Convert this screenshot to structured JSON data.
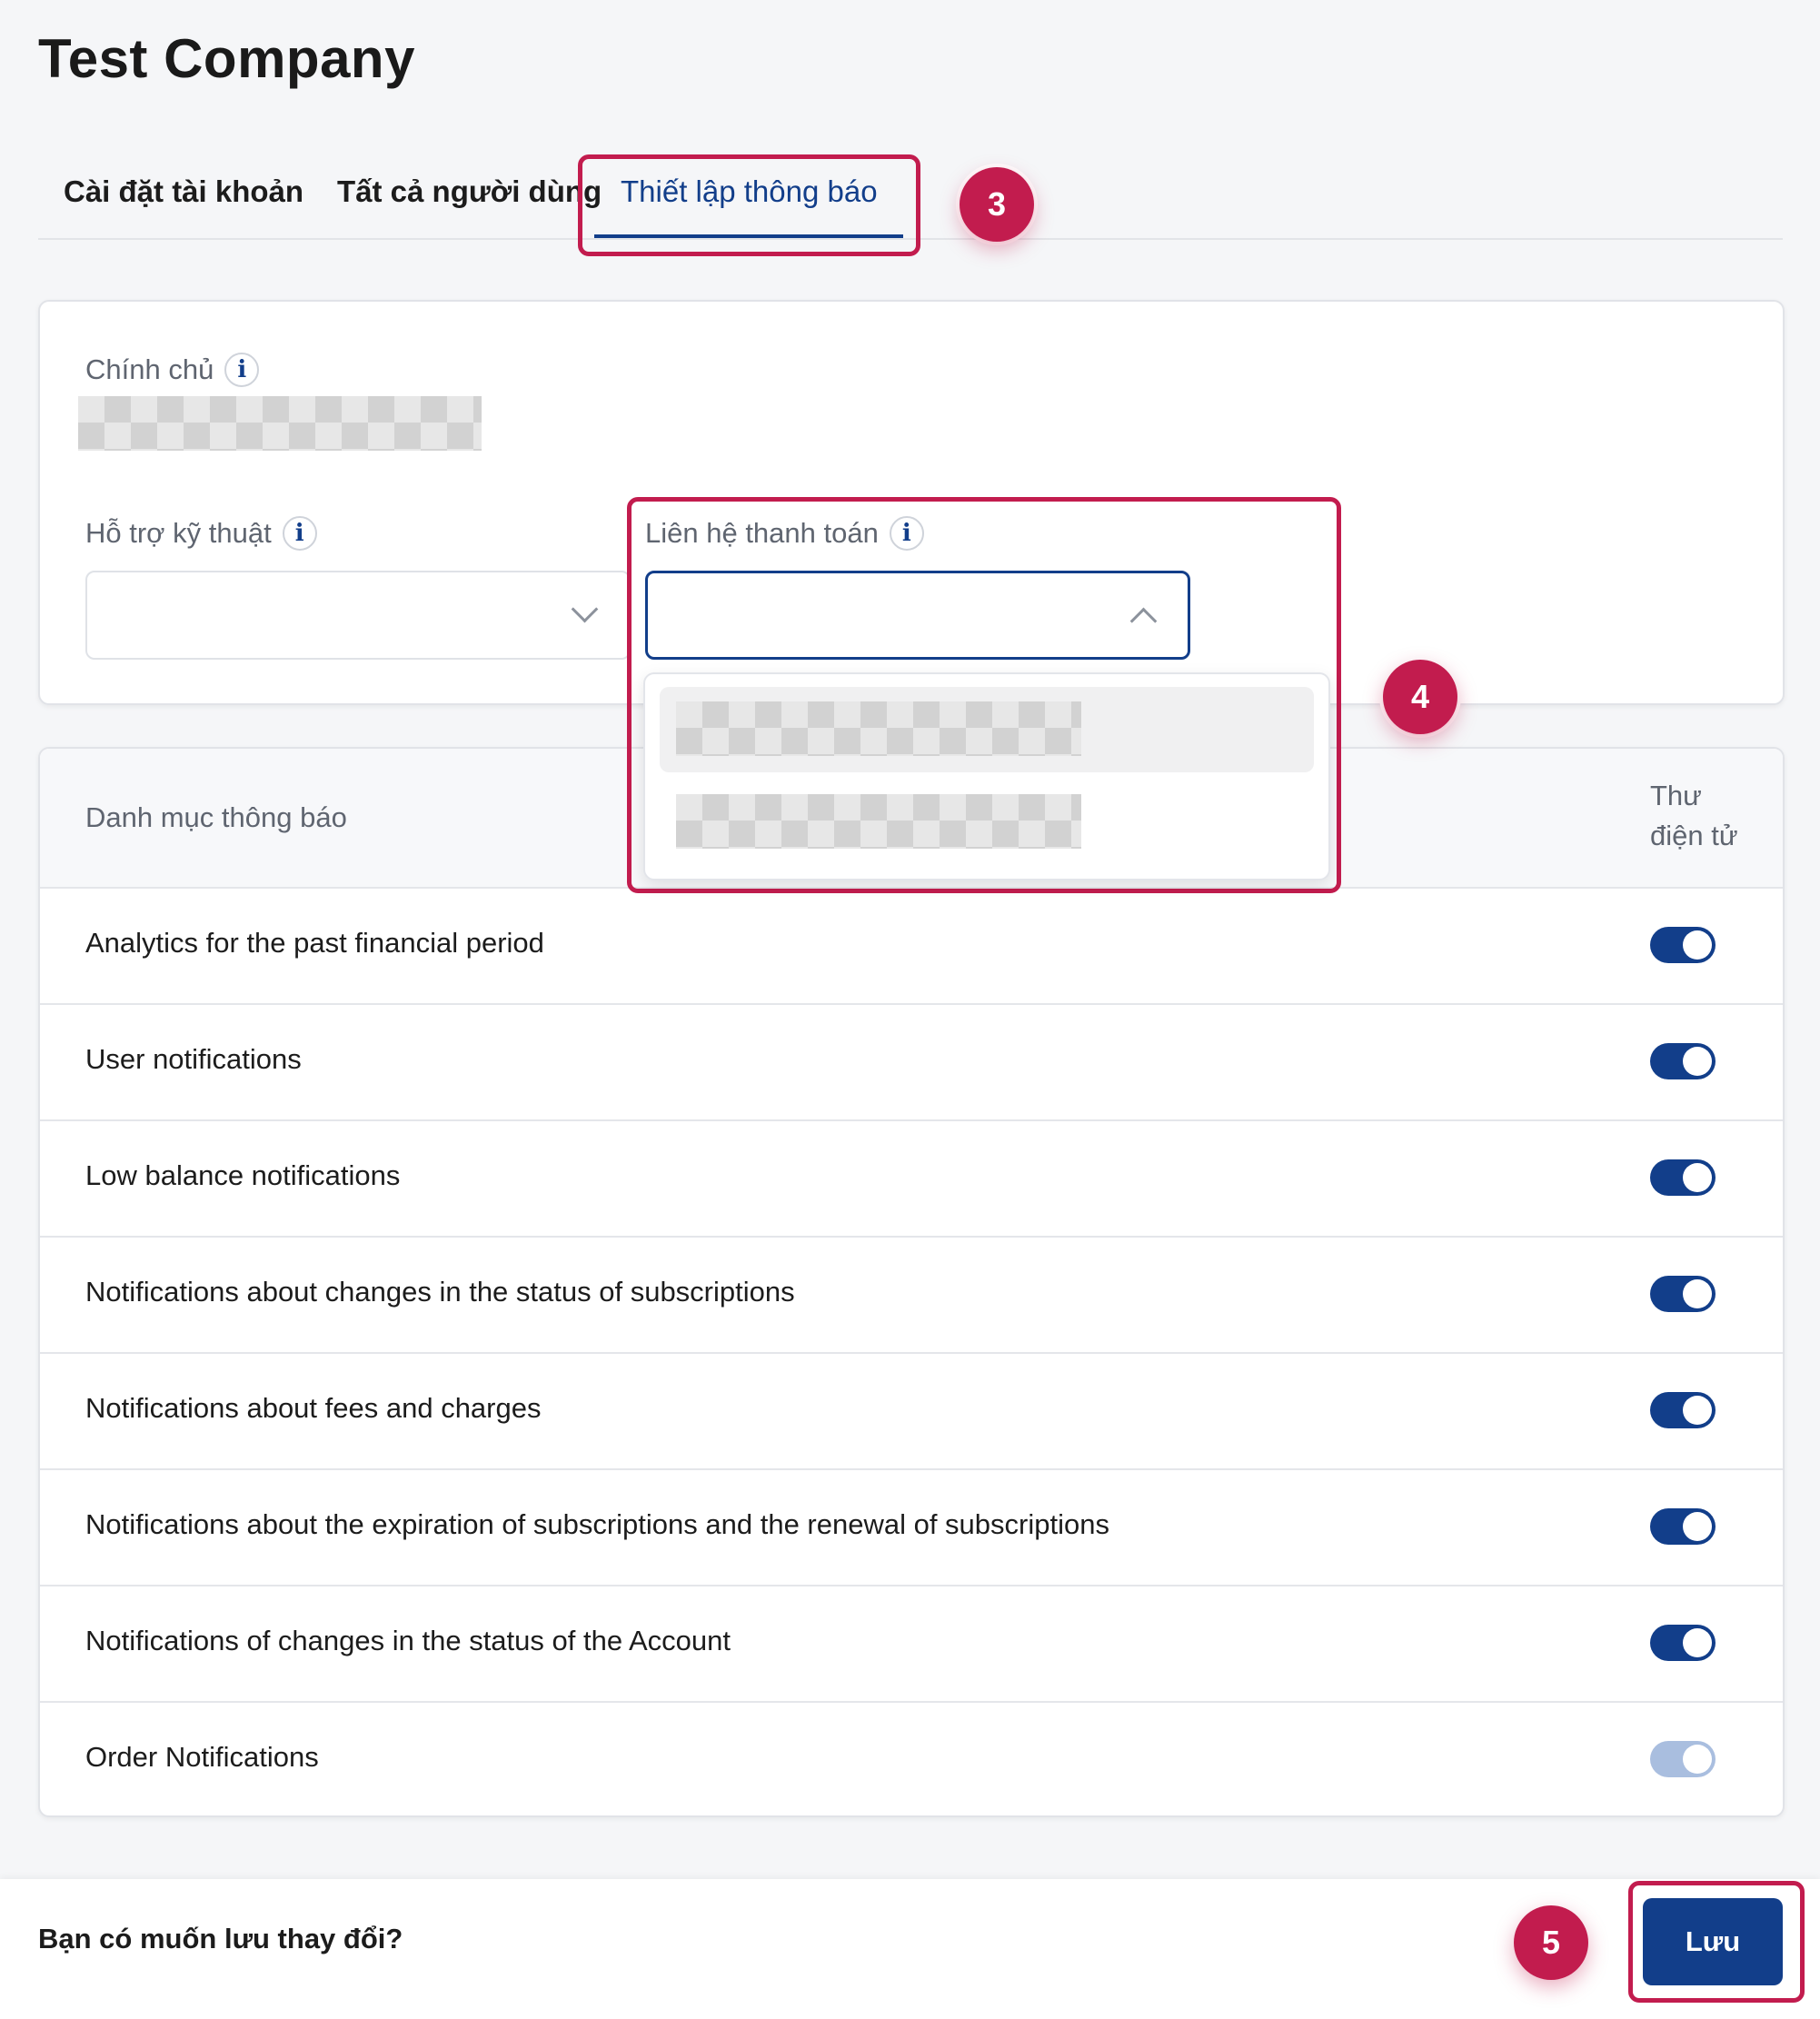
{
  "page": {
    "title": "Test Company"
  },
  "tabs": [
    {
      "label": "Cài đặt tài khoản"
    },
    {
      "label": "Tất cả người dùng"
    },
    {
      "label": "Thiết lập thông báo",
      "active": true
    }
  ],
  "contacts": {
    "owner_label": "Chính chủ",
    "tech_support_label": "Hỗ trợ kỹ thuật",
    "billing_label": "Liên hệ thanh toán",
    "tech_support_value": "",
    "billing_value": ""
  },
  "table": {
    "header_left": "Danh mục thông báo",
    "header_right": "Thư điện tử",
    "rows": [
      {
        "label": "Analytics for the past financial period",
        "enabled": true
      },
      {
        "label": "User notifications",
        "enabled": true
      },
      {
        "label": "Low balance notifications",
        "enabled": true
      },
      {
        "label": "Notifications about changes in the status of subscriptions",
        "enabled": true
      },
      {
        "label": "Notifications about fees and charges",
        "enabled": true
      },
      {
        "label": "Notifications about the expiration of subscriptions and the renewal of subscriptions",
        "enabled": true
      },
      {
        "label": "Notifications of changes in the status of the Account",
        "enabled": true
      },
      {
        "label": "Order Notifications",
        "enabled": true,
        "disabled": true
      }
    ]
  },
  "footer": {
    "question": "Bạn có muốn lưu thay đổi?",
    "save_label": "Lưu"
  },
  "callouts": {
    "tabs": "3",
    "billing": "4",
    "save": "5"
  },
  "colors": {
    "primary": "#123e8a",
    "accent": "#c21c4e"
  },
  "icons": {
    "info": "info-icon",
    "chevron_down": "chevron-down-icon",
    "chevron_up": "chevron-up-icon"
  }
}
